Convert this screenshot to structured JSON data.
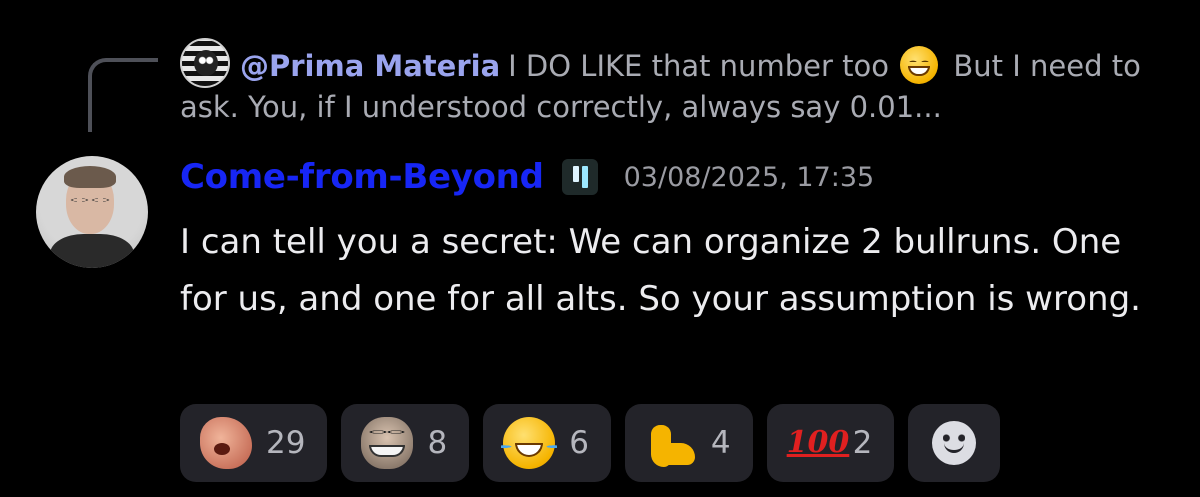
{
  "reply": {
    "mention": "@Prima Materia",
    "text_before_emoji": "I DO LIKE that number too",
    "emoji": "grinning-face-emoji",
    "text_after_emoji": "But I need to ask. You, if I understood correctly, always say 0.01..."
  },
  "message": {
    "author": "Come-from-Beyond",
    "author_color": "#1726f5",
    "badge": "server-tag-icon",
    "timestamp": "03/08/2025, 17:35",
    "body": "I can tell you a secret: We can organize 2 bullruns. One for us, and one for all alts. So your assumption is wrong."
  },
  "reactions": [
    {
      "emoji": "custom-face-emoji",
      "count": "29"
    },
    {
      "emoji": "troll-face-emoji",
      "count": "8"
    },
    {
      "emoji": "face-with-tears-of-joy-emoji",
      "count": "6"
    },
    {
      "emoji": "flexed-biceps-emoji",
      "count": "4"
    },
    {
      "emoji": "hundred-points-emoji",
      "glyph": "100",
      "count": "2"
    }
  ],
  "add_reaction": {
    "icon": "add-reaction-smiley-icon"
  }
}
